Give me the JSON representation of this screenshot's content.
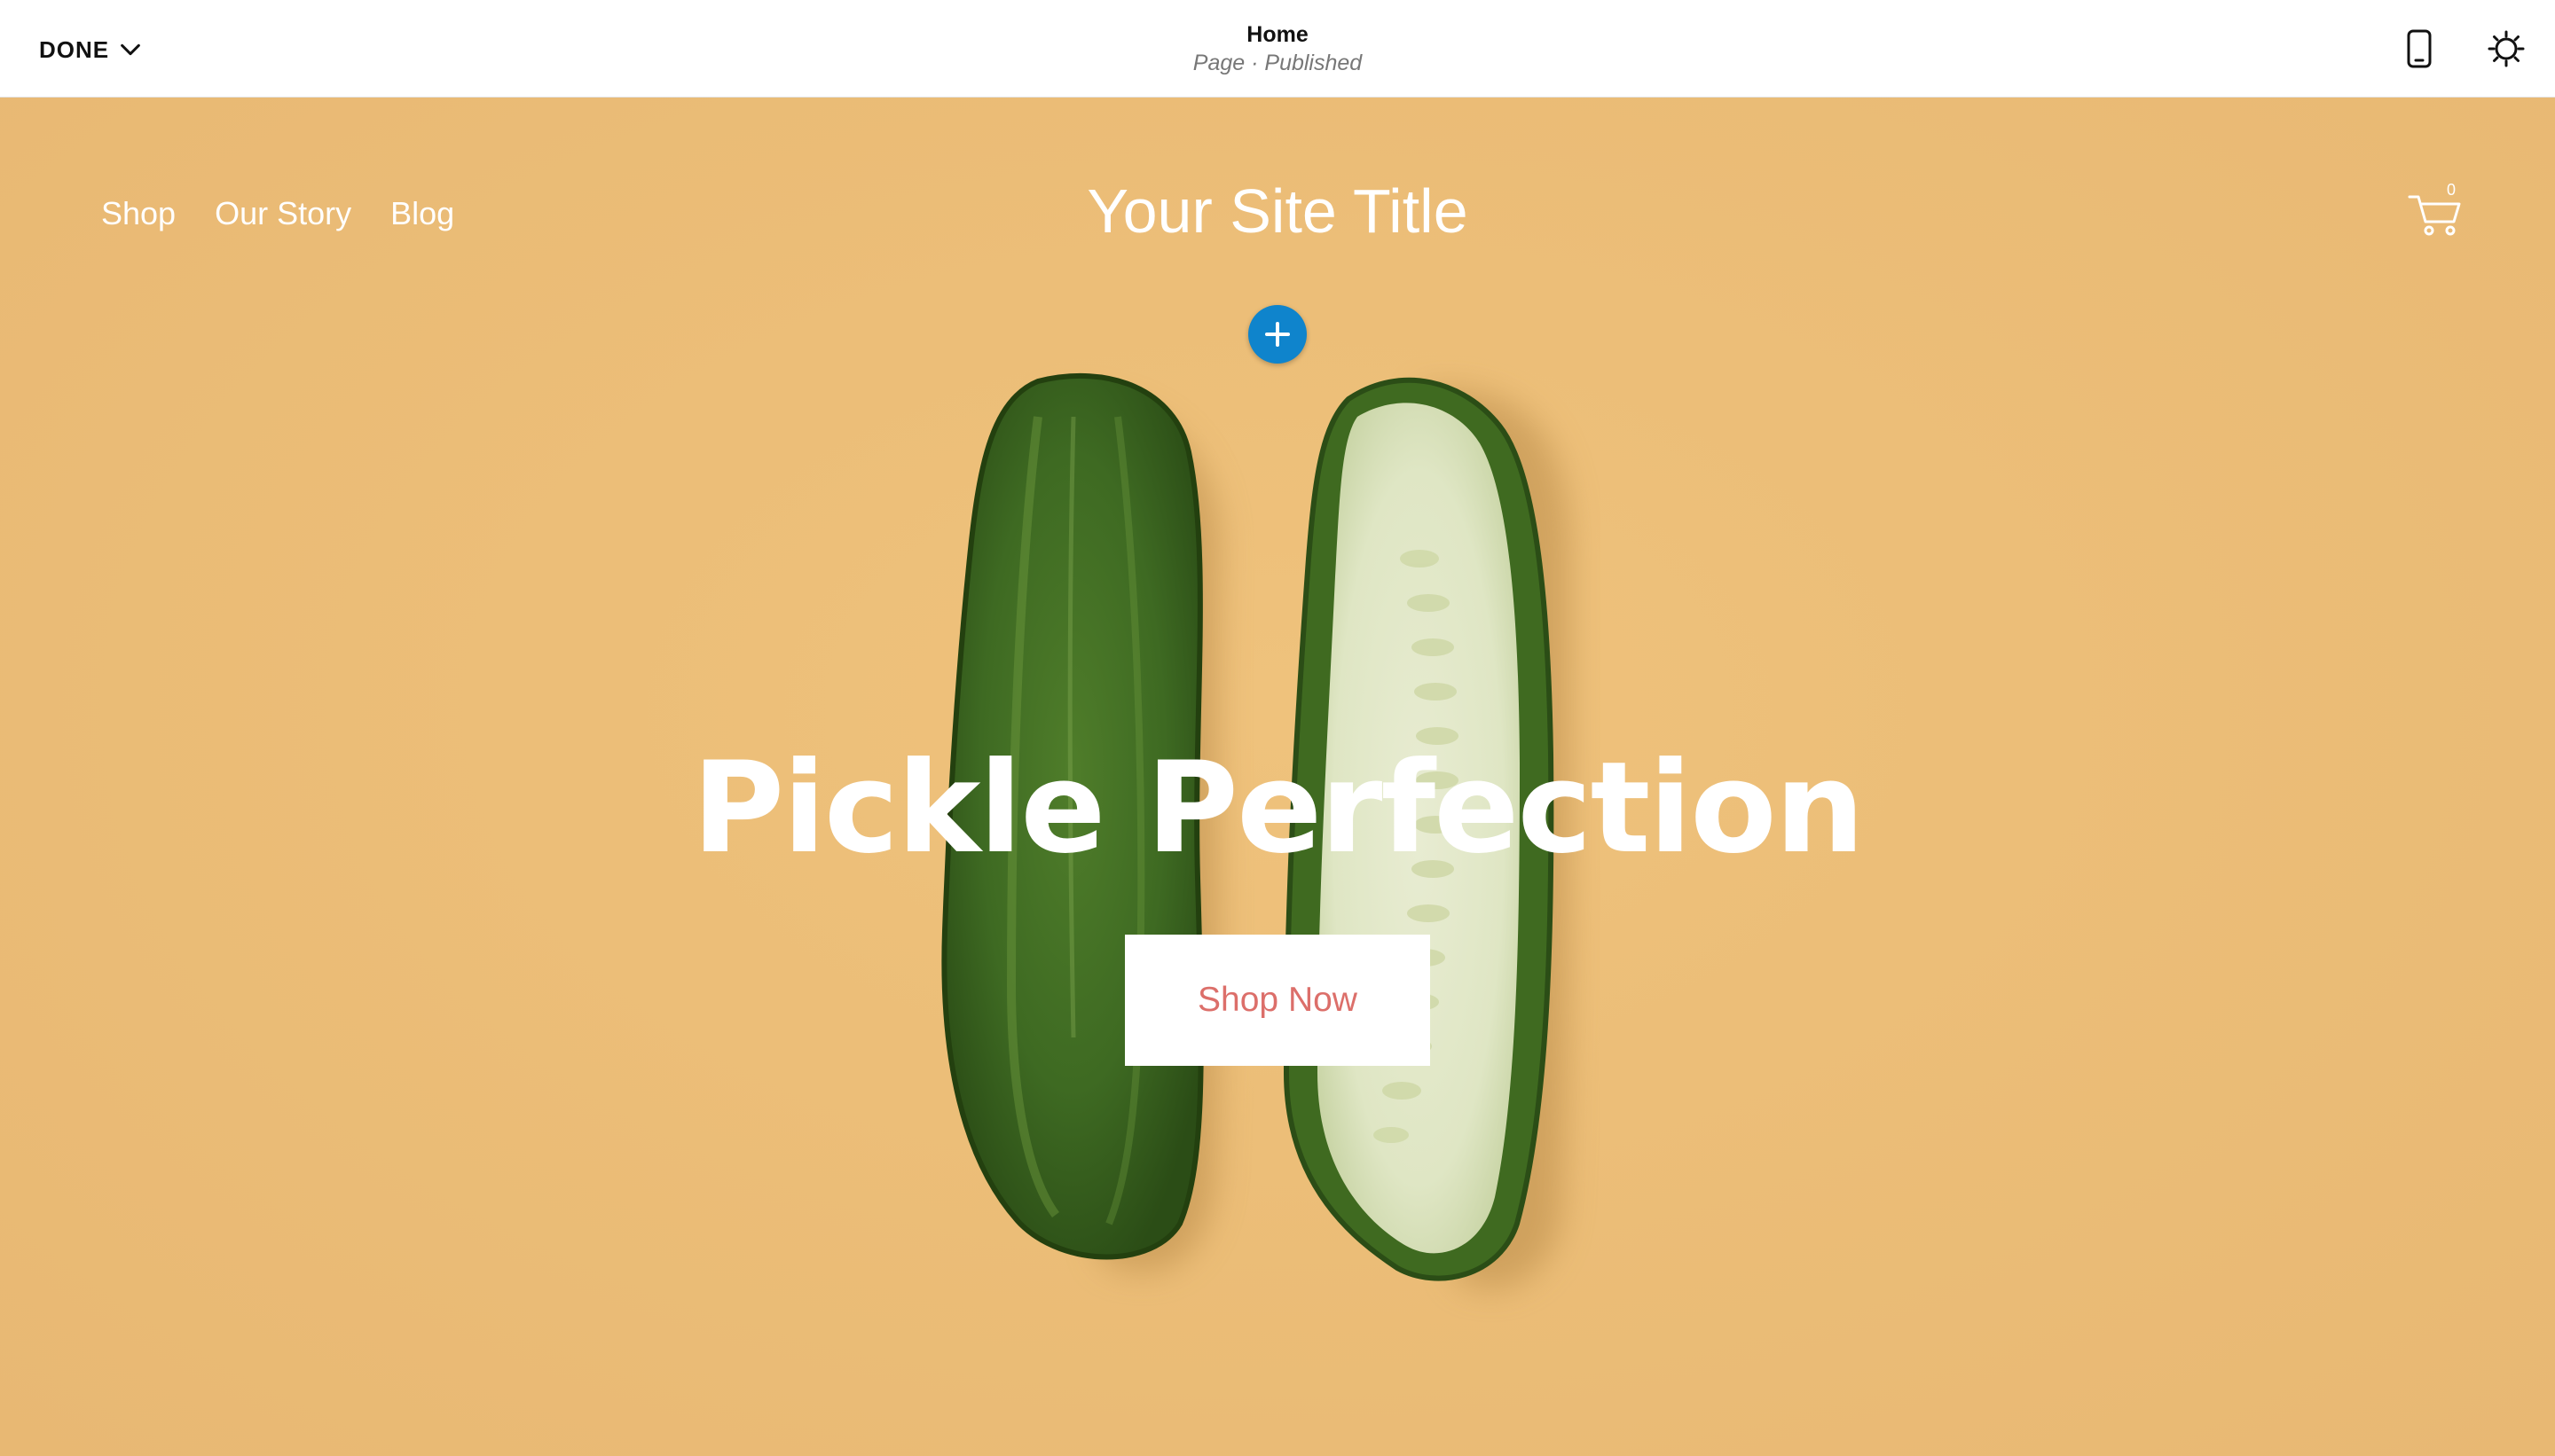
{
  "editor": {
    "done_label": "DONE",
    "page_title": "Home",
    "page_status": "Page · Published",
    "icons": [
      "chevron-down-icon",
      "mobile-preview-icon",
      "site-styles-icon"
    ]
  },
  "site": {
    "nav": [
      "Shop",
      "Our Story",
      "Blog"
    ],
    "title": "Your Site Title",
    "cart_count": "0"
  },
  "hero": {
    "headline": "Pickle Perfection",
    "cta_label": "Shop Now",
    "background_color": "#ecbe78",
    "cta_text_color": "#dc6f6a",
    "add_button_color": "#0f84cc"
  }
}
